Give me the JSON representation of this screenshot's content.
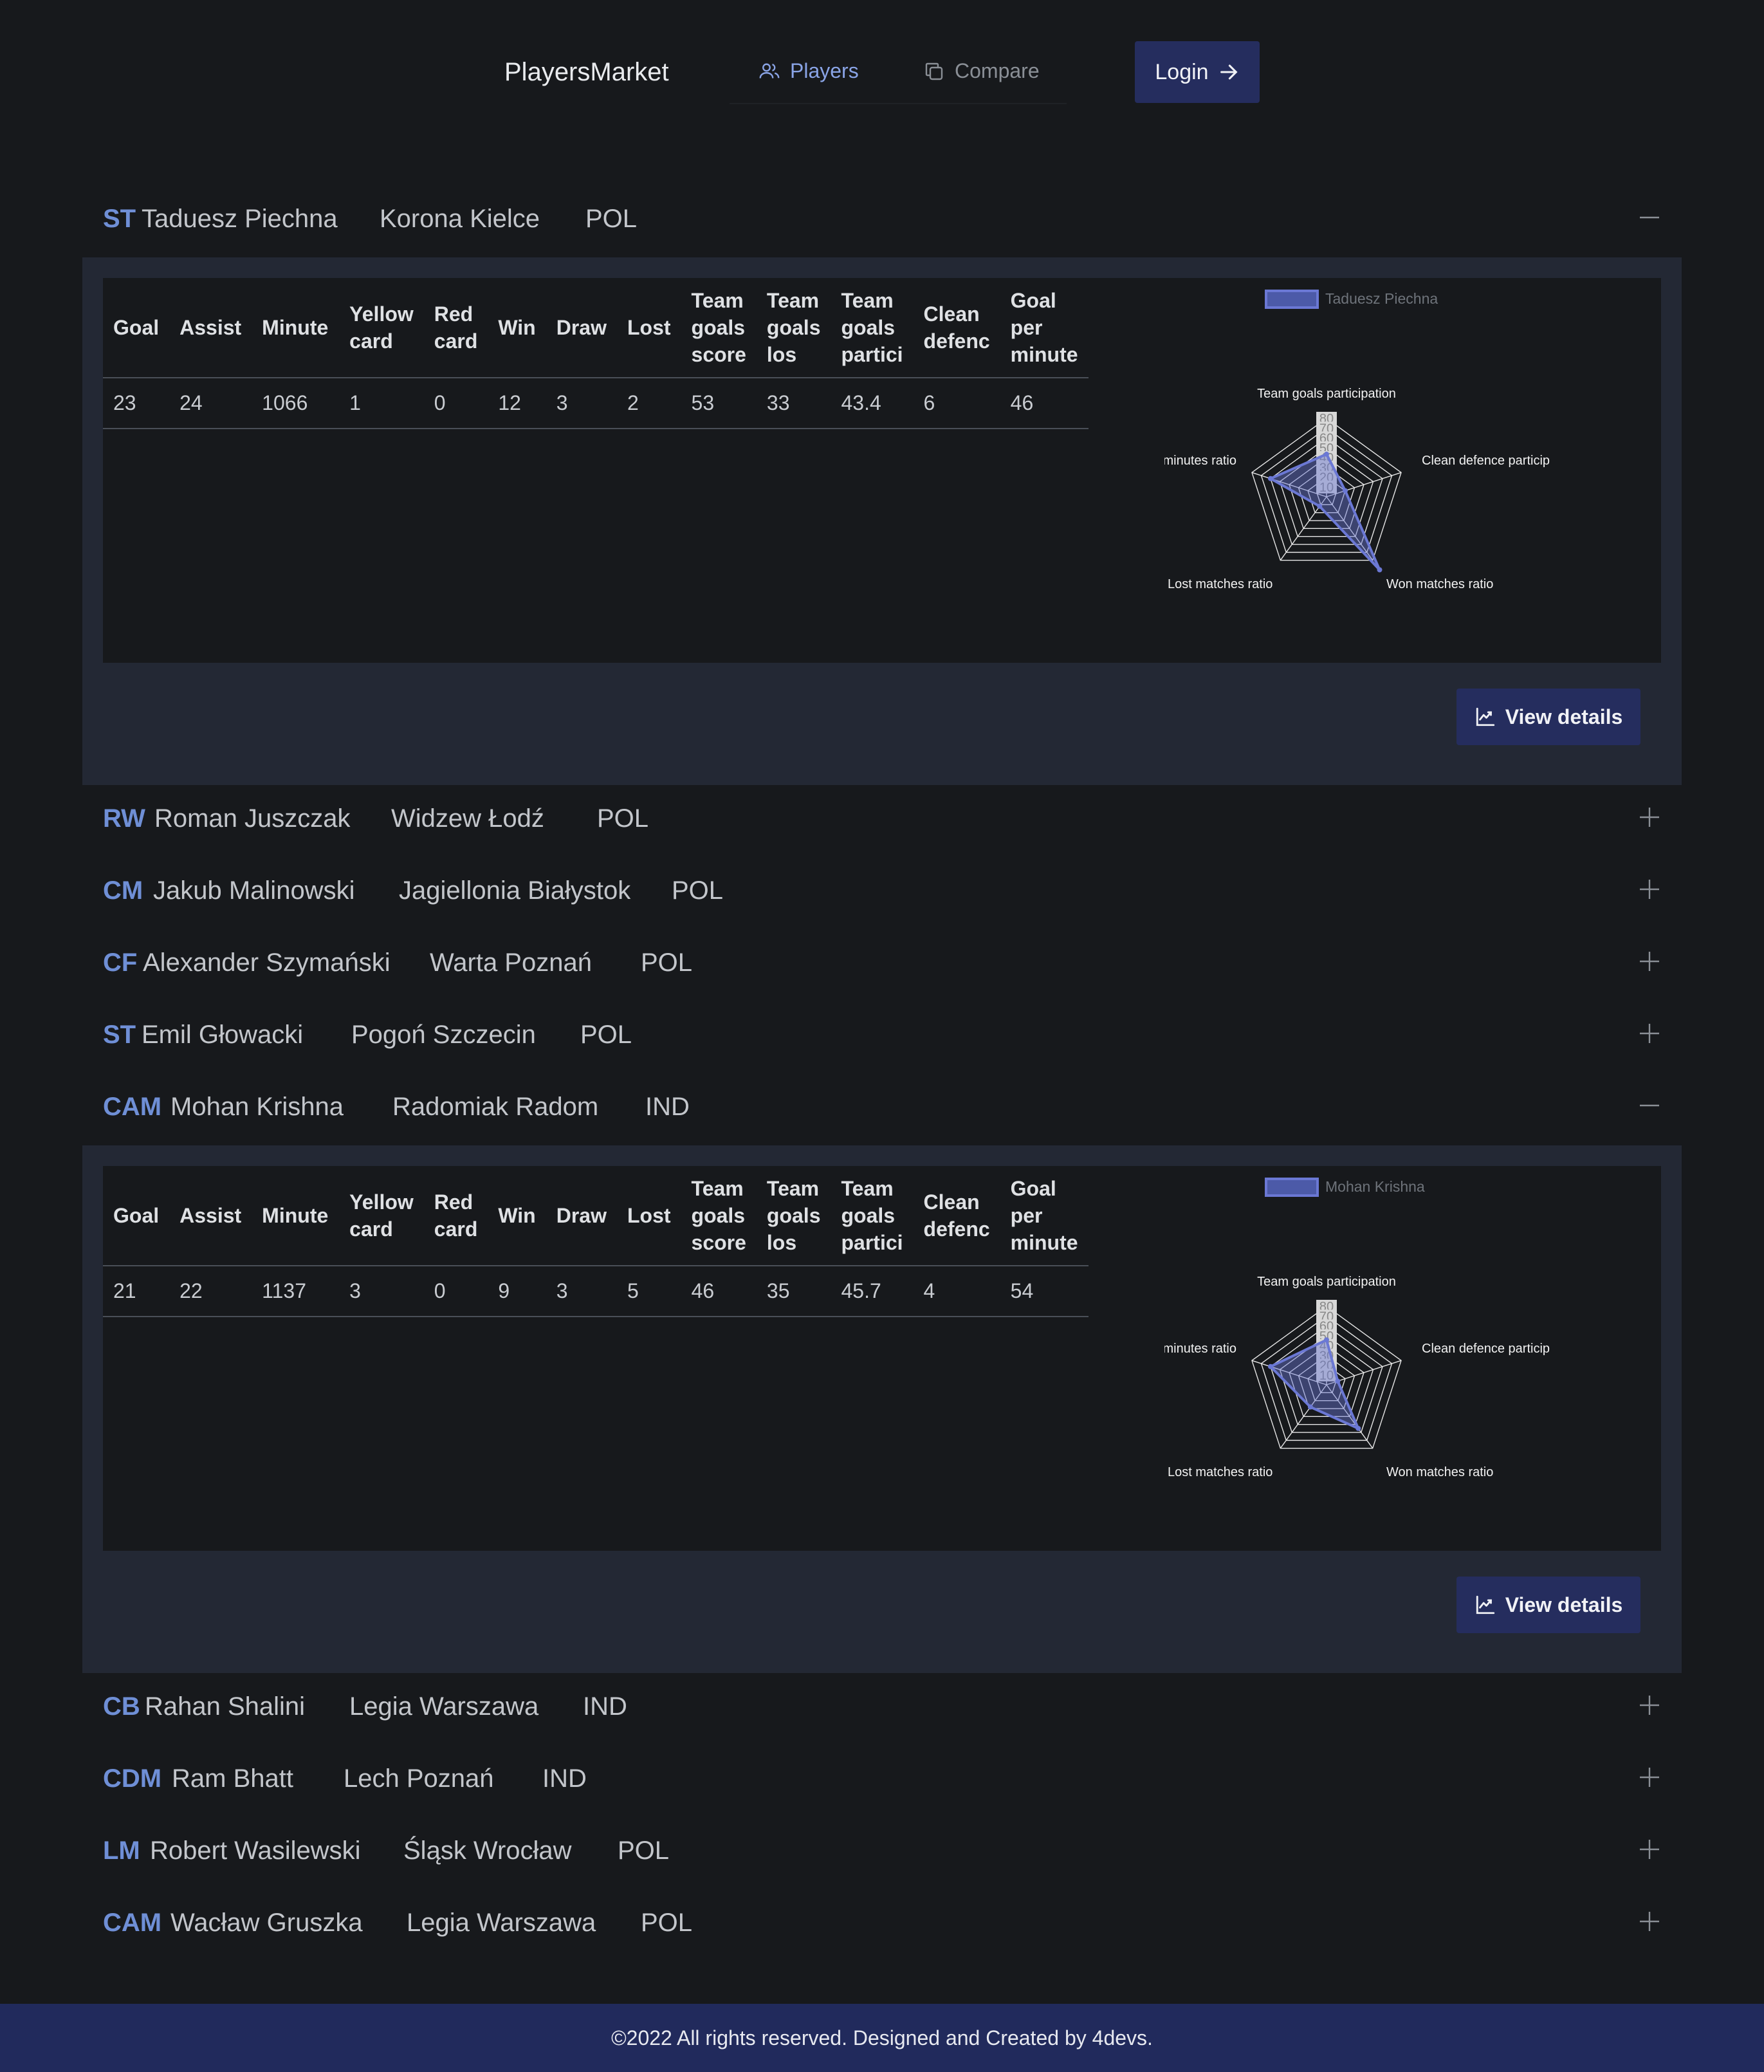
{
  "brand": "PlayersMarket",
  "nav": {
    "players": "Players",
    "compare": "Compare",
    "login": "Login"
  },
  "table_headers": [
    "Goal",
    "Assist",
    "Minute",
    "Yellow card",
    "Red card",
    "Win",
    "Draw",
    "Lost",
    "Team goals score",
    "Team goals los",
    "Team goals partici",
    "Clean defenc",
    "Goal per minute"
  ],
  "radar_axes": [
    "Team goals participation",
    "Clean defence particip",
    "Won matches ratio",
    "Lost matches ratio",
    "minutes ratio"
  ],
  "radar_ticks": [
    "80",
    "70",
    "60",
    "50",
    "40",
    "30",
    "20",
    "10"
  ],
  "view_details": "View details",
  "players": [
    {
      "pos": "ST",
      "name": "Taduesz Piechna",
      "club": "Korona Kielce",
      "country": "POL",
      "expanded": true,
      "stats": [
        "23",
        "24",
        "1066",
        "1",
        "0",
        "12",
        "3",
        "2",
        "53",
        "33",
        "43.4",
        "6",
        "46"
      ],
      "radar": [
        43.4,
        20,
        92,
        12,
        60
      ]
    },
    {
      "pos": "RW",
      "name": "Roman Juszczak",
      "club": "Widzew Łodź",
      "country": "POL",
      "expanded": false
    },
    {
      "pos": "CM",
      "name": "Jakub Malinowski",
      "club": "Jagiellonia Białystok",
      "country": "POL",
      "expanded": false
    },
    {
      "pos": "CF",
      "name": "Alexander Szymański",
      "club": "Warta Poznań",
      "country": "POL",
      "expanded": false
    },
    {
      "pos": "ST",
      "name": "Emil Głowacki",
      "club": "Pogoń Szczecin",
      "country": "POL",
      "expanded": false
    },
    {
      "pos": "CAM",
      "name": "Mohan Krishna",
      "club": "Radomiak Radom",
      "country": "IND",
      "expanded": true,
      "stats": [
        "21",
        "22",
        "1137",
        "3",
        "0",
        "9",
        "3",
        "5",
        "46",
        "35",
        "45.7",
        "4",
        "54"
      ],
      "radar": [
        45.7,
        12,
        55,
        28,
        60
      ]
    },
    {
      "pos": "CB",
      "name": "Rahan Shalini",
      "club": "Legia Warszawa",
      "country": "IND",
      "expanded": false
    },
    {
      "pos": "CDM",
      "name": "Ram Bhatt",
      "club": "Lech Poznań",
      "country": "IND",
      "expanded": false
    },
    {
      "pos": "LM",
      "name": "Robert Wasilewski",
      "club": "Śląsk Wrocław",
      "country": "POL",
      "expanded": false
    },
    {
      "pos": "CAM",
      "name": "Wacław Gruszka",
      "club": "Legia Warszawa",
      "country": "POL",
      "expanded": false
    }
  ],
  "footer": "©2022 All rights reserved. Designed and Created by 4devs.",
  "colors": {
    "accent": "#6f8fd6",
    "button": "#252d5e",
    "footer": "#212a5c",
    "panel": "#232834",
    "radar_fill": "#6b78d4"
  }
}
